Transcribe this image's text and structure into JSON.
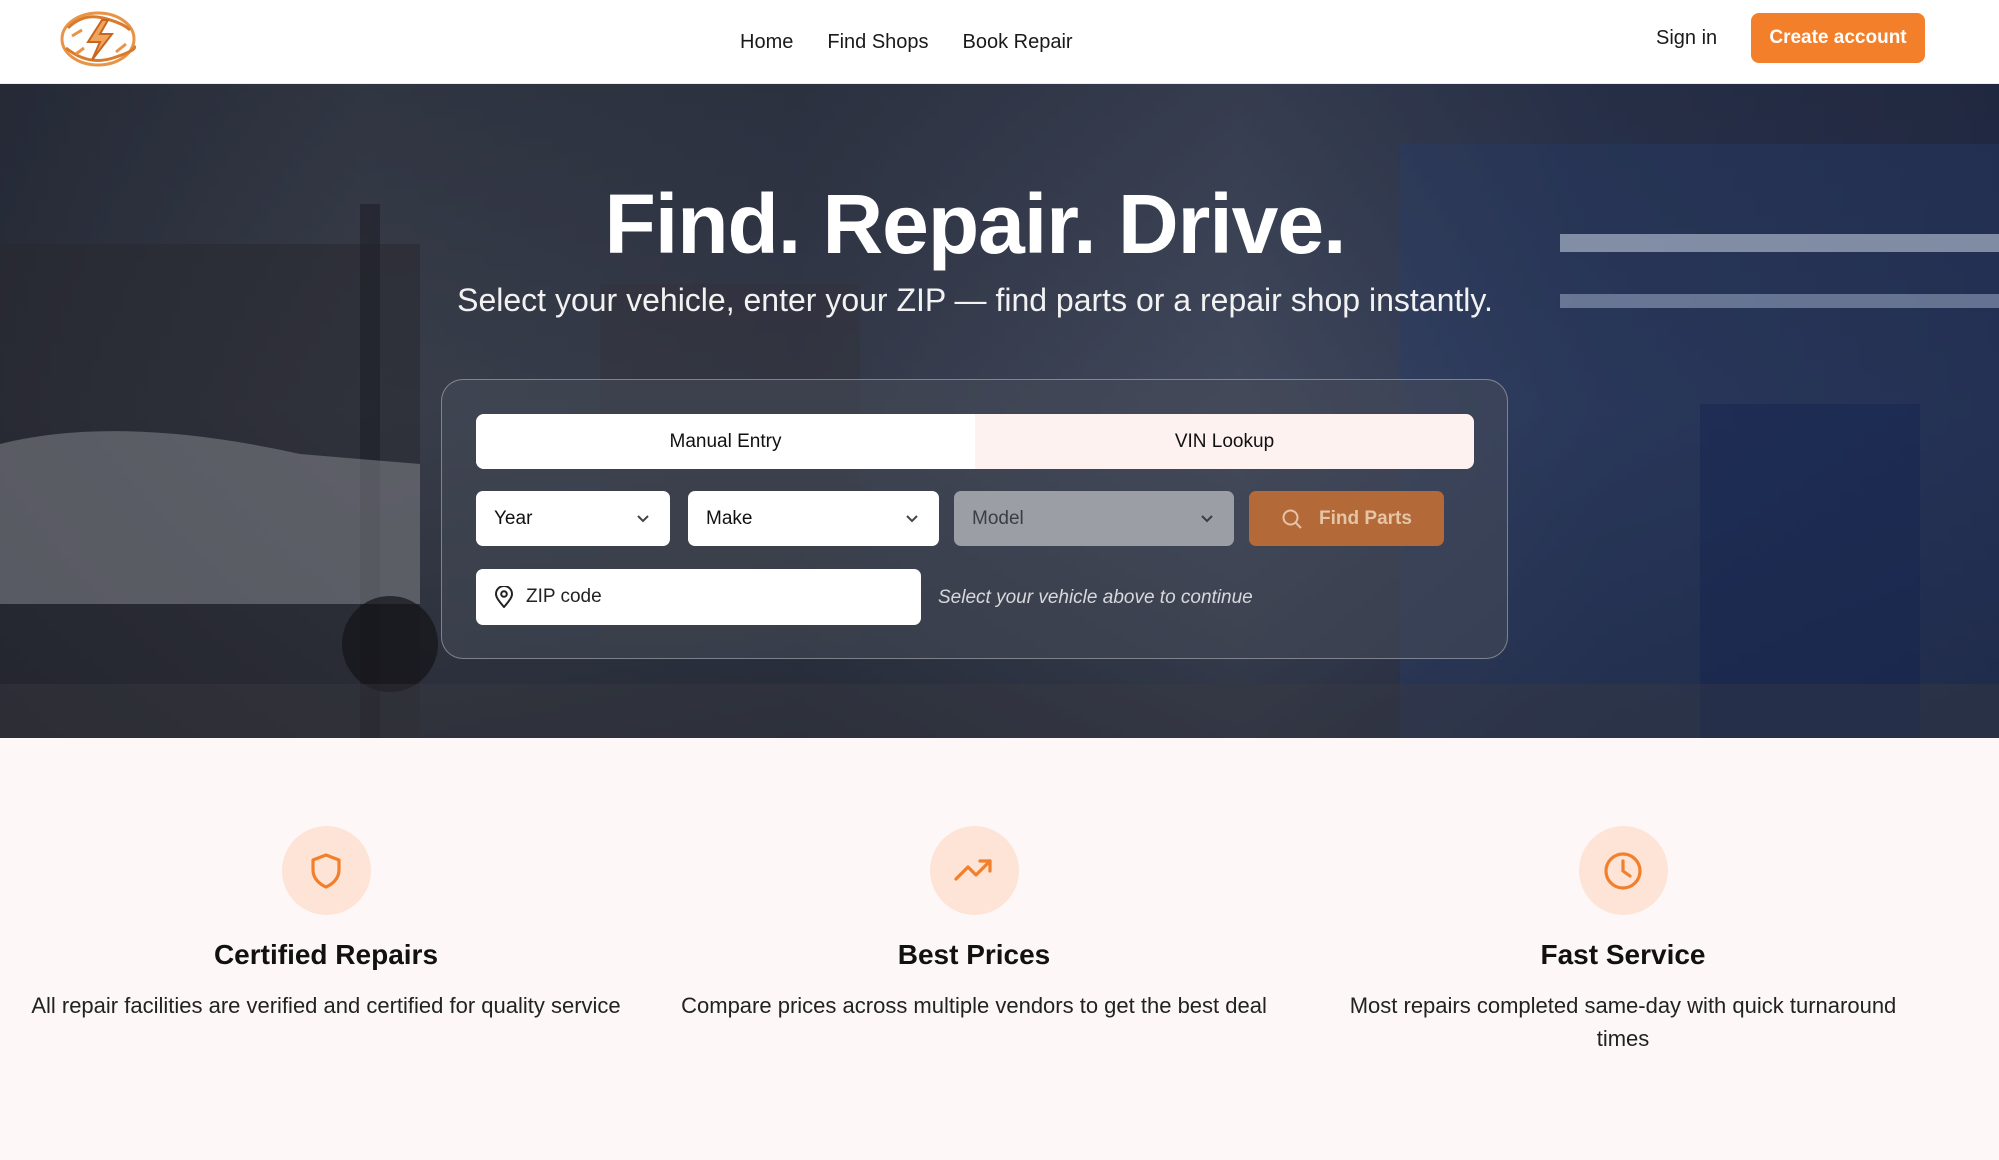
{
  "header": {
    "nav": [
      "Home",
      "Find Shops",
      "Book Repair"
    ],
    "signin_label": "Sign in",
    "create_label": "Create account"
  },
  "hero": {
    "title": "Find. Repair. Drive.",
    "subtitle": "Select your vehicle, enter your ZIP — find parts or a repair shop instantly.",
    "tabs": [
      {
        "label": "Manual Entry",
        "active": true
      },
      {
        "label": "VIN Lookup",
        "active": false
      }
    ],
    "year_placeholder": "Year",
    "make_placeholder": "Make",
    "model_placeholder": "Model",
    "find_label": "Find Parts",
    "zip_placeholder": "ZIP code",
    "hint": "Select your vehicle above to continue"
  },
  "features": [
    {
      "icon": "shield-icon",
      "title": "Certified Repairs",
      "text": "All repair facilities are verified and certified for quality service"
    },
    {
      "icon": "trending-up-icon",
      "title": "Best Prices",
      "text": "Compare prices across multiple vendors to get the best deal"
    },
    {
      "icon": "clock-icon",
      "title": "Fast Service",
      "text": "Most repairs completed same-day with quick turnaround times"
    }
  ],
  "colors": {
    "accent": "#f47f2a",
    "icon_bg": "#fde4d6",
    "page_bg": "#fdf8f7"
  }
}
